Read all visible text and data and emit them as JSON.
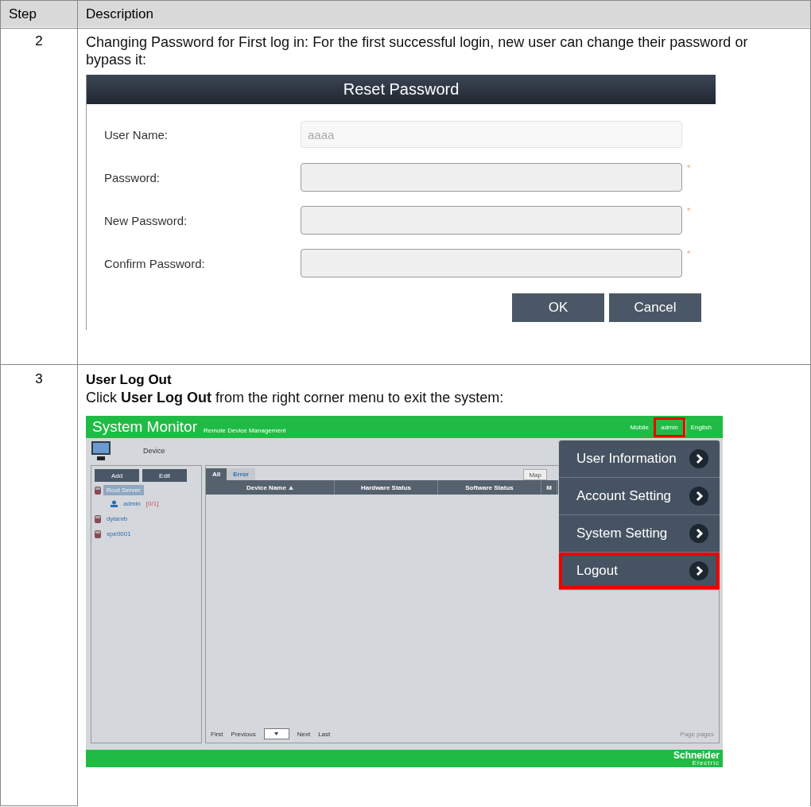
{
  "table": {
    "columns": [
      "Step",
      "Description"
    ],
    "rows": [
      {
        "step": "2",
        "text": "Changing Password for First log in: For the first successful login, new user can change their password or bypass it:",
        "dialog": {
          "title": "Reset Password",
          "fields": [
            {
              "label": "User Name:",
              "value": "aaaa",
              "disabled": true
            },
            {
              "label": "Password:",
              "disabled": false,
              "mark": "*"
            },
            {
              "label": "New Password:",
              "disabled": false,
              "mark": "*"
            },
            {
              "label": "Confirm Password:",
              "disabled": false,
              "mark": "*"
            }
          ],
          "buttons": [
            "OK",
            "Cancel"
          ]
        }
      },
      {
        "step": "3",
        "title": "User Log Out",
        "text": "Click **User Log Out** from the right corner menu to exit the system:",
        "app": {
          "brand": "System Monitor",
          "subtitle": "Remote Device Management",
          "top_links": [
            {
              "label": "Mobile",
              "highlighted": false
            },
            {
              "label": "admin",
              "highlighted": true
            },
            {
              "label": "English",
              "highlighted": false
            }
          ],
          "section": "Device",
          "sidebar_buttons": [
            "Add",
            "Edit"
          ],
          "tree": [
            {
              "label": "Root Server",
              "selected": true,
              "children": [
                {
                  "label": "admin",
                  "count": "[0/1]",
                  "selected": false
                }
              ]
            },
            {
              "label": "dylanrb",
              "selected": false
            },
            {
              "label": "xpe0001",
              "selected": false
            }
          ],
          "tabs": [
            {
              "label": "All",
              "selected": true
            },
            {
              "label": "Error",
              "selected": false
            }
          ],
          "toolbar": [
            "Map"
          ],
          "columns": [
            {
              "label": "Device Name",
              "sorted": true
            },
            {
              "label": "Hardware Status",
              "sorted": false
            },
            {
              "label": "Software Status",
              "sorted": false
            },
            {
              "label": "M"
            }
          ],
          "pager": [
            "First",
            "Previous",
            "Next",
            "Last"
          ],
          "page_info": "Page pages",
          "menu": [
            {
              "label": "User Information",
              "highlighted": false
            },
            {
              "label": "Account Setting",
              "highlighted": false
            },
            {
              "label": "System Setting",
              "highlighted": false
            },
            {
              "label": "Logout",
              "highlighted": true
            }
          ],
          "logo": {
            "name": "Schneider",
            "sub": "Electric"
          }
        }
      }
    ]
  }
}
